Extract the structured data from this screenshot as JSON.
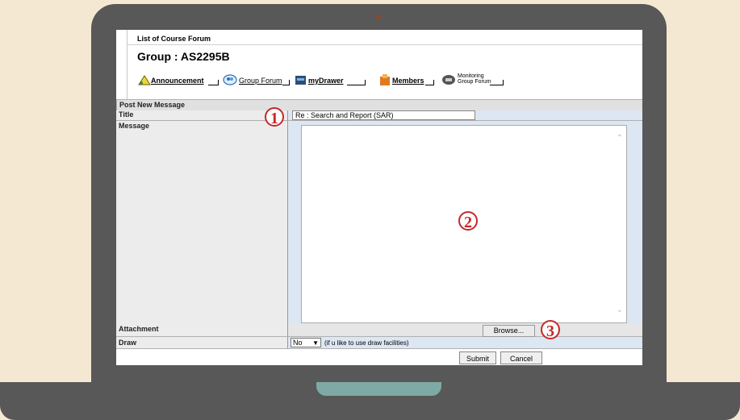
{
  "page": {
    "breadcrumb": "List of Course Forum",
    "group_title": "Group : AS2295B"
  },
  "nav": {
    "items": [
      {
        "label": "Announcement",
        "icon": "announcement-icon"
      },
      {
        "label": "Group Forum",
        "icon": "group-forum-icon"
      },
      {
        "label": "myDrawer",
        "icon": "drawer-icon"
      },
      {
        "label": "Members",
        "icon": "members-icon"
      },
      {
        "label": "Monitoring Group Forum",
        "icon": "monitoring-icon"
      }
    ]
  },
  "form": {
    "section_title": "Post New Message",
    "title_label": "Title",
    "title_value": "Re : Search and Report (SAR)",
    "message_label": "Message",
    "attachment_label": "Attachment",
    "browse_label": "Browse...",
    "draw_label": "Draw",
    "draw_value": "No",
    "draw_note": "(if u like to use draw facilities)",
    "submit_label": "Submit",
    "cancel_label": "Cancel"
  },
  "annotations": [
    "1",
    "2",
    "3"
  ],
  "colors": {
    "background": "#f5e8d3",
    "laptop": "#585858",
    "annotation": "#c62828",
    "value_column": "#dde6f3"
  }
}
